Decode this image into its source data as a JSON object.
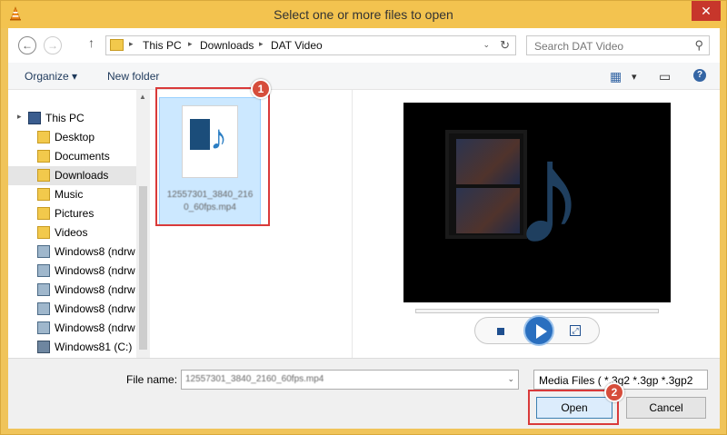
{
  "window": {
    "title": "Select one or more files to open",
    "close_glyph": "✕",
    "app_icon": "vlc-cone-icon"
  },
  "address": {
    "back_glyph": "←",
    "forward_glyph": "→",
    "up_glyph": "↑",
    "crumbs": [
      "This PC",
      "Downloads",
      "DAT Video"
    ],
    "separator": "▸",
    "dropdown_glyph": "⌄",
    "refresh_glyph": "↻"
  },
  "search": {
    "placeholder": "Search DAT Video",
    "icon_glyph": "⚲"
  },
  "toolbar": {
    "organize": "Organize",
    "organize_arrow": "▾",
    "new_folder": "New folder",
    "view_glyph": "▦",
    "view_arrow": "▾",
    "pane_glyph": "▭",
    "help_glyph": "?"
  },
  "nav": {
    "items": [
      {
        "label": "This PC",
        "icon": "computer-icon"
      },
      {
        "label": "Desktop",
        "icon": "folder-icon"
      },
      {
        "label": "Documents",
        "icon": "folder-icon"
      },
      {
        "label": "Downloads",
        "icon": "downloads-folder-icon"
      },
      {
        "label": "Music",
        "icon": "folder-icon"
      },
      {
        "label": "Pictures",
        "icon": "folder-icon"
      },
      {
        "label": "Videos",
        "icon": "folder-icon"
      },
      {
        "label": "Windows8 (ndrw",
        "icon": "network-drive-icon"
      },
      {
        "label": "Windows8 (ndrw",
        "icon": "network-drive-icon"
      },
      {
        "label": "Windows8 (ndrw",
        "icon": "network-drive-icon"
      },
      {
        "label": "Windows8 (ndrw",
        "icon": "network-drive-icon"
      },
      {
        "label": "Windows8 (ndrw",
        "icon": "network-drive-icon"
      },
      {
        "label": "Windows81 (C:)",
        "icon": "local-disk-icon"
      }
    ],
    "selected_index": 3,
    "expand_glyph": "▸",
    "scroll_up": "▲",
    "scroll_down": "▼"
  },
  "files": [
    {
      "name": "12557301_3840_2160_60fps.mp4",
      "icon": "media-file-icon",
      "note_glyph": "♪"
    }
  ],
  "annotations": {
    "badge1": "1",
    "badge2": "2",
    "color": "#d93a3a"
  },
  "preview": {
    "music_glyph": "♪",
    "fullscreen_glyph": "⤢"
  },
  "bottom": {
    "file_name_label": "File name:",
    "file_name_value": "12557301_3840_2160_60fps.mp4",
    "dropdown_glyph": "⌄",
    "file_type": "Media Files ( *.3g2 *.3gp *.3gp2",
    "open_label": "Open",
    "cancel_label": "Cancel"
  },
  "colors": {
    "titlebar": "#f3c34f",
    "close": "#c7362b",
    "selection": "#cce8ff",
    "badge": "#d64d3b"
  }
}
